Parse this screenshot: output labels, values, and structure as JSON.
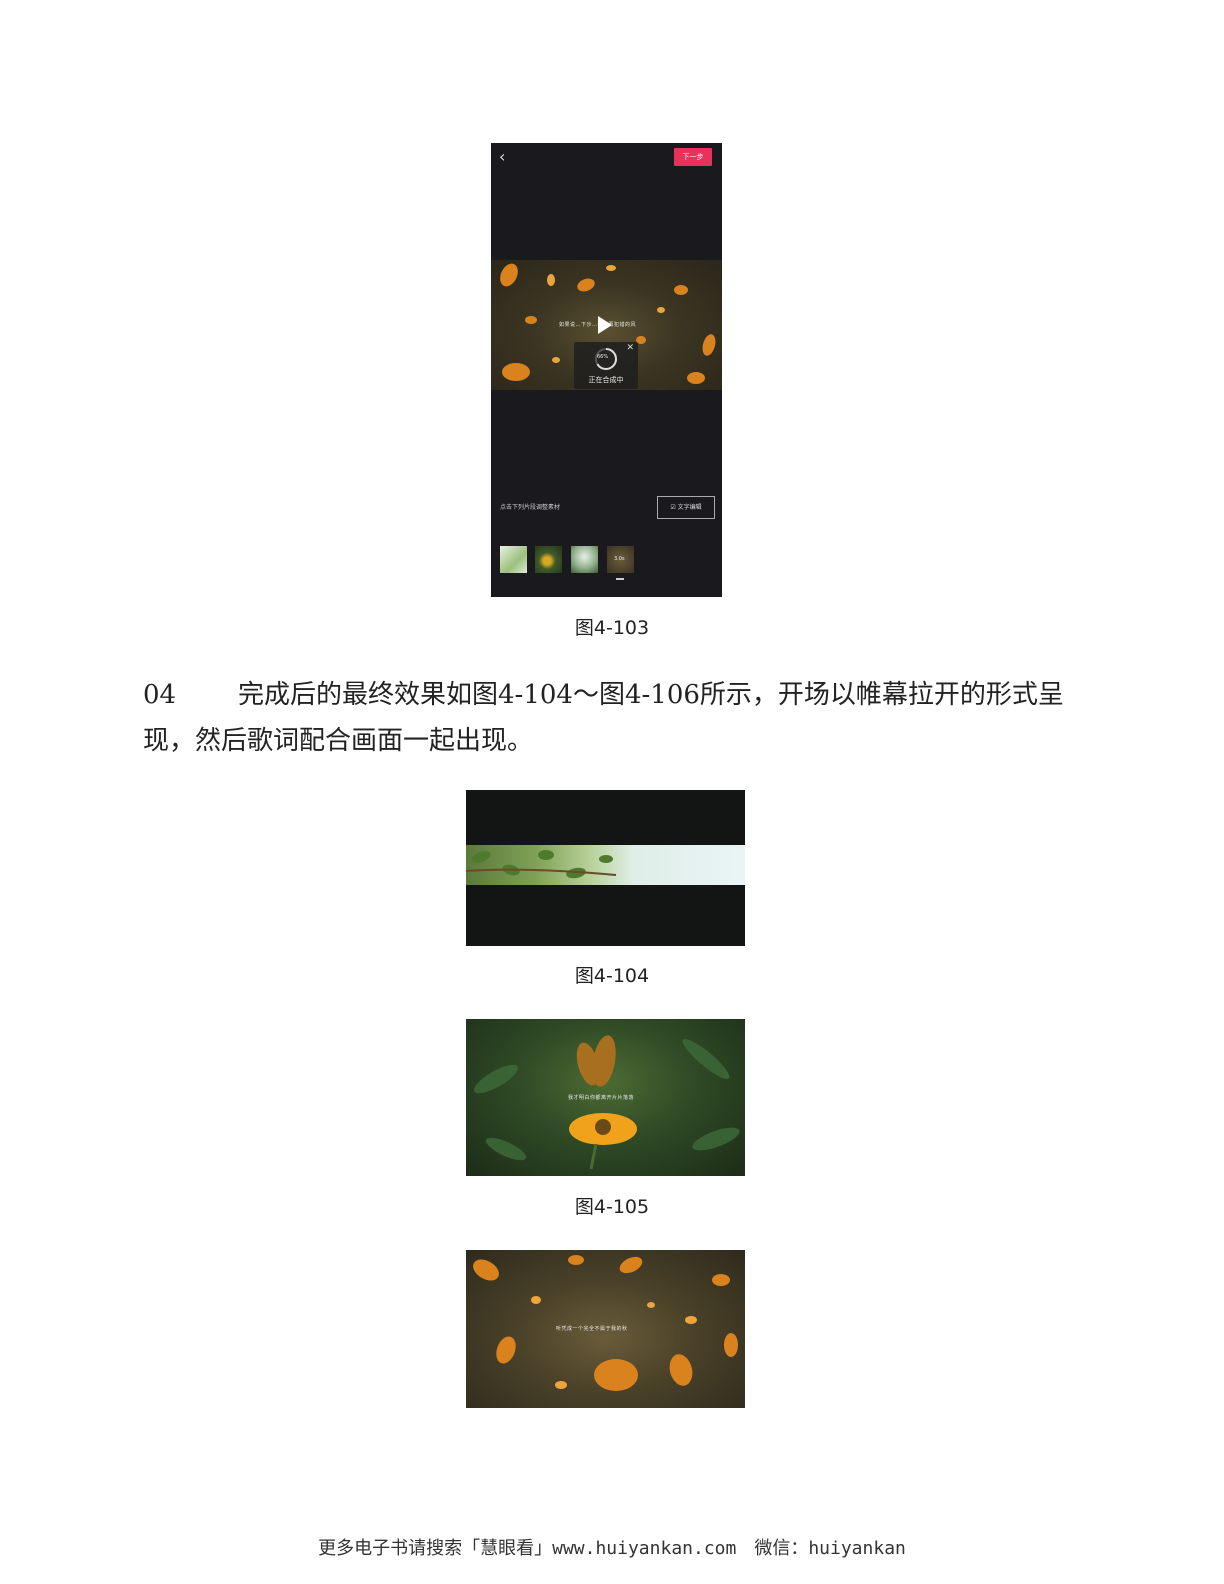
{
  "figure_103": {
    "caption": "图4-103",
    "next_button": "下一步",
    "lyric_overlay": "如果说…下沙…我不再犯错的风",
    "progress_percent": "66%",
    "progress_label": "正在合成中",
    "hint_text": "点击下列片段调整素材",
    "edit_text_button": "文字编辑",
    "thumbnail_labels": [
      "",
      "",
      "",
      "3.0s"
    ]
  },
  "paragraph": {
    "step_number": "04",
    "text": "完成后的最终效果如图4-104～图4-106所示，开场以帷幕拉开的形式呈现，然后歌词配合画面一起出现。"
  },
  "figure_104": {
    "caption": "图4-104"
  },
  "figure_105": {
    "caption": "图4-105",
    "lyric_overlay": "我才明白你都离开片片落落"
  },
  "figure_106": {
    "lyric_overlay": "听凭成一个完全不属于我的秋"
  },
  "footer": {
    "text": "更多电子书请搜索「慧眼看」www.huiyankan.com　微信：huiyankan"
  },
  "colors": {
    "accent_pink": "#e8315b",
    "phone_bg": "#1a1a1e",
    "leaf_orange": "#d9821e"
  }
}
